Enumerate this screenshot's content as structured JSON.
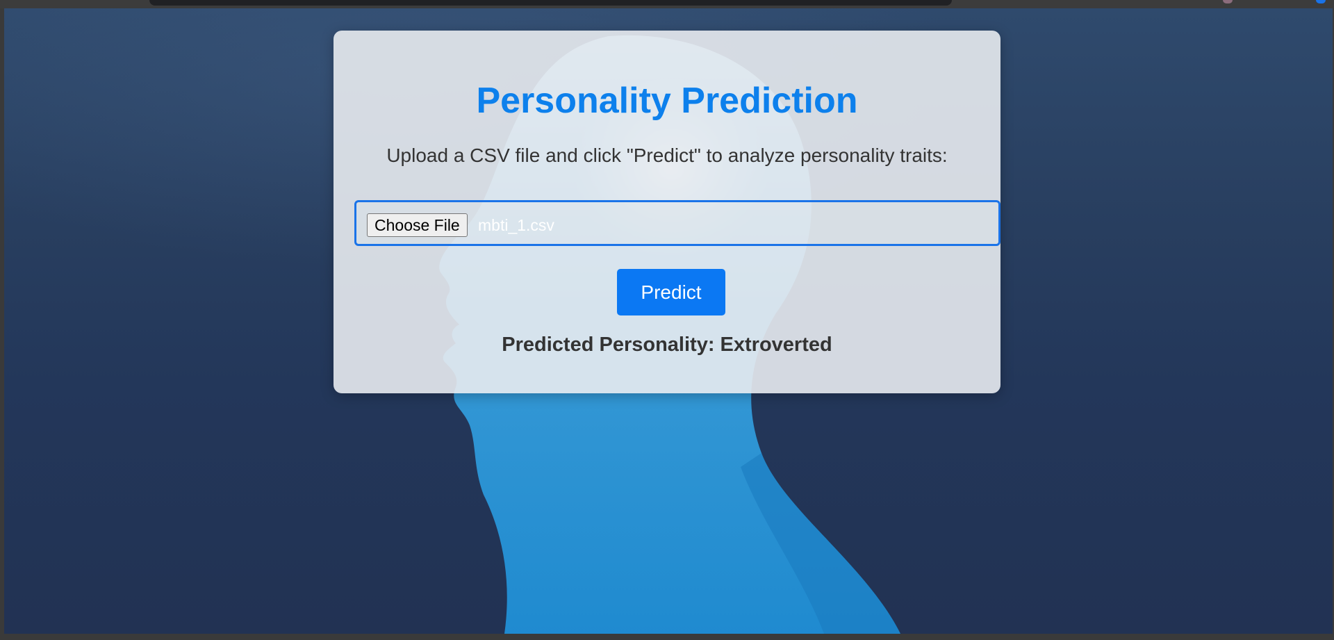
{
  "page": {
    "title": "Personality Prediction",
    "instructions": "Upload a CSV file and click \"Predict\" to analyze personality traits:"
  },
  "upload": {
    "choose_file_label": "Choose File",
    "selected_file": "mbti_1.csv"
  },
  "actions": {
    "predict_label": "Predict"
  },
  "result": {
    "text": "Predicted Personality: Extroverted"
  },
  "colors": {
    "accent": "#0d80ec",
    "button": "#0b78f3",
    "background": "#283e5f"
  },
  "icons": {
    "background_art": "human-head-silhouette"
  }
}
